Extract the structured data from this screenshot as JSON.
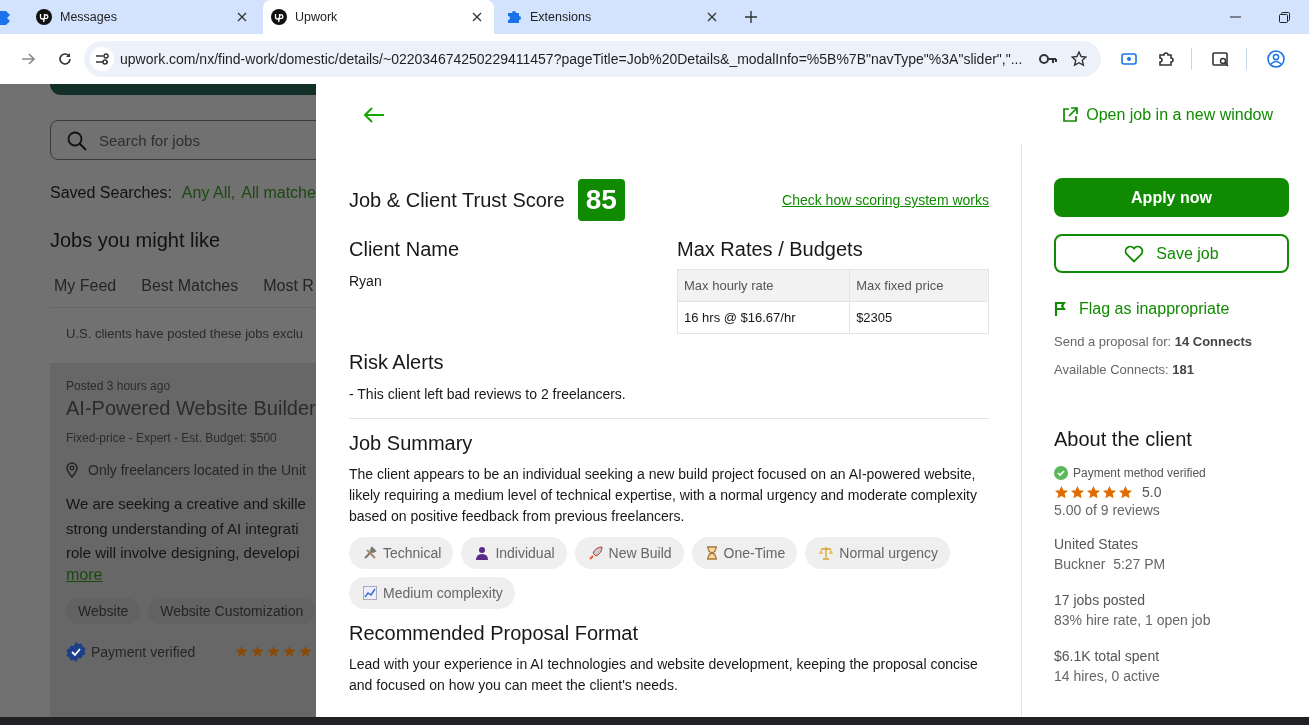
{
  "browser": {
    "tabs": [
      {
        "title": "Messages",
        "selected": false
      },
      {
        "title": "Upwork",
        "selected": true
      },
      {
        "title": "Extensions",
        "selected": false
      }
    ],
    "url": "upwork.com/nx/find-work/domestic/details/~022034674250229411457?pageTitle=Job%20Details&_modalInfo=%5B%7B\"navType\"%3A\"slider\",\"..."
  },
  "background_page": {
    "search": {
      "placeholder": "Search for jobs"
    },
    "saved_searches": {
      "label": "Saved Searches:",
      "items": [
        "Any All,",
        "All matche"
      ]
    },
    "heading": "Jobs you might like",
    "tabs": [
      "My Feed",
      "Best Matches",
      "Most R"
    ],
    "notice": "U.S. clients have posted these jobs exclu",
    "job": {
      "posted": "Posted 3 hours ago",
      "title": "AI-Powered Website Builder",
      "meta": "Fixed-price - Expert - Est. Budget: $500",
      "location": "Only freelancers located in the Unit",
      "description_lines": [
        "We are seeking a creative and skille",
        "strong understanding of AI integrati",
        "role will involve designing, developi"
      ],
      "more": "more",
      "skills": [
        "Website",
        "Website Customization"
      ],
      "payment": "Payment verified",
      "stars": 5
    }
  },
  "panel": {
    "open_link": "Open job in a new window",
    "score": {
      "title": "Job & Client Trust Score",
      "value": "85",
      "link": "Check how scoring system works"
    },
    "client": {
      "heading": "Client Name",
      "name": "Ryan"
    },
    "rates": {
      "heading": "Max Rates / Budgets",
      "columns": [
        "Max hourly rate",
        "Max fixed price"
      ],
      "rows": [
        [
          "16 hrs @ $16.67/hr",
          "$2305"
        ]
      ]
    },
    "risk": {
      "heading": "Risk Alerts",
      "items": [
        "- This client left bad reviews to 2 freelancers."
      ]
    },
    "summary": {
      "heading": "Job Summary",
      "text": "The client appears to be an individual seeking a new build project focused on an AI-powered website, likely requiring a medium level of technical expertise, with a normal urgency and moderate complexity based on positive feedback from previous freelancers.",
      "tags": [
        "Technical",
        "Individual",
        "New Build",
        "One-Time",
        "Normal urgency",
        "Medium complexity"
      ]
    },
    "proposal": {
      "heading": "Recommended Proposal Format",
      "text": "Lead with your experience in AI technologies and website development, keeping the proposal concise and focused on how you can meet the client's needs."
    },
    "sidebar": {
      "apply": "Apply now",
      "save": "Save job",
      "flag": "Flag as inappropriate",
      "connects": [
        "Send a proposal for: **14 Connects**",
        "Available Connects: **181**"
      ],
      "about": {
        "heading": "About the client",
        "payment": "Payment method verified",
        "stars": 5,
        "rating": "5.0",
        "reviews": "5.00 of 9 reviews",
        "groups": [
          [
            "United States",
            "Buckner  5:27 PM"
          ],
          [
            "17 jobs posted",
            "83% hire rate, 1 open job"
          ],
          [
            "$6.1K total spent",
            "14 hires, 0 active"
          ]
        ]
      }
    }
  }
}
